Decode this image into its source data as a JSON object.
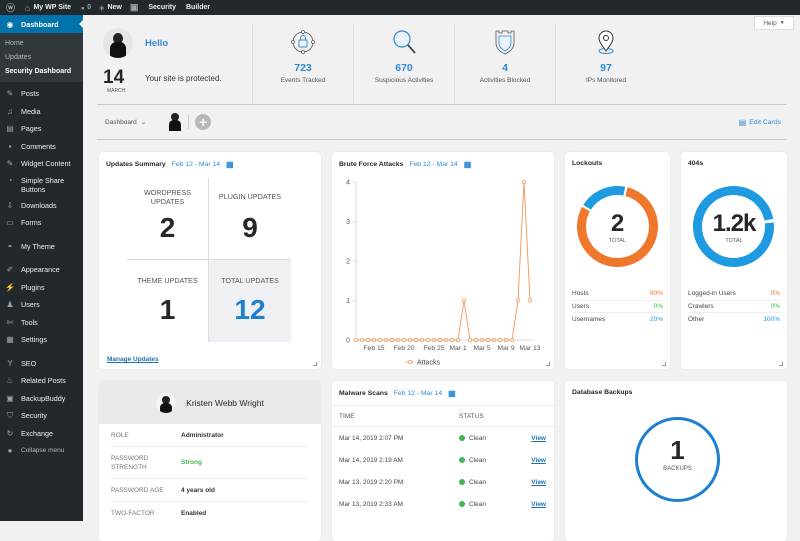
{
  "adminbar": {
    "wp_icon": "wordpress-logo-icon",
    "site_name": "My WP Site",
    "comments_count": "0",
    "new_label": "New",
    "security_label": "Security",
    "builder_label": "Builder"
  },
  "sidebar": {
    "active": "Dashboard",
    "submenu": [
      "Home",
      "Updates",
      "Security Dashboard"
    ],
    "items": [
      {
        "label": "Posts",
        "icon": "pin-icon"
      },
      {
        "label": "Media",
        "icon": "media-icon"
      },
      {
        "label": "Pages",
        "icon": "pages-icon"
      },
      {
        "label": "Comments",
        "icon": "comment-icon"
      },
      {
        "label": "Widget Content",
        "icon": "pin-icon"
      },
      {
        "label": "Simple Share Buttons",
        "icon": "share-icon"
      },
      {
        "label": "Downloads",
        "icon": "download-icon"
      },
      {
        "label": "Forms",
        "icon": "forms-icon"
      },
      {
        "label": "My Theme",
        "icon": "theme-icon"
      },
      {
        "label": "Appearance",
        "icon": "brush-icon"
      },
      {
        "label": "Plugins",
        "icon": "plugin-icon"
      },
      {
        "label": "Users",
        "icon": "users-icon"
      },
      {
        "label": "Tools",
        "icon": "wrench-icon"
      },
      {
        "label": "Settings",
        "icon": "settings-icon"
      },
      {
        "label": "SEO",
        "icon": "seo-icon"
      },
      {
        "label": "Related Posts",
        "icon": "flame-icon"
      },
      {
        "label": "BackupBuddy",
        "icon": "backup-icon"
      },
      {
        "label": "Security",
        "icon": "shield-icon"
      },
      {
        "label": "Exchange",
        "icon": "exchange-icon"
      }
    ],
    "collapse": "Collapse menu"
  },
  "hero": {
    "day": "14",
    "month": "MARCH",
    "greeting": "Hello",
    "message": "Your site is protected.",
    "stats": [
      {
        "value": "723",
        "label": "Events Tracked"
      },
      {
        "value": "670",
        "label": "Suspicious Activities"
      },
      {
        "value": "4",
        "label": "Activities Blocked"
      },
      {
        "value": "97",
        "label": "IPs Monitored"
      }
    ],
    "help": "Help"
  },
  "toolbar": {
    "dashboard_select": "Dashboard",
    "edit_cards": "Edit Cards"
  },
  "updates": {
    "title": "Updates Summary",
    "range": "Feb 12 - Mar 14",
    "cells": [
      {
        "label": "WORDPRESS UPDATES",
        "value": "2"
      },
      {
        "label": "PLUGIN UPDATES",
        "value": "9"
      },
      {
        "label": "THEME UPDATES",
        "value": "1"
      },
      {
        "label": "TOTAL UPDATES",
        "value": "12"
      }
    ],
    "manage": "Manage Updates"
  },
  "brute": {
    "title": "Brute Force Attacks",
    "range": "Feb 12 - Mar 14"
  },
  "chart_data": {
    "type": "line",
    "title": "Brute Force Attacks",
    "xlabel": "",
    "ylabel": "",
    "ylim": [
      0,
      4
    ],
    "yticks": [
      "0",
      "1",
      "2",
      "3",
      "4"
    ],
    "xticks": [
      "Feb 15",
      "Feb 20",
      "Feb 25",
      "Mar 1",
      "Mar 5",
      "Mar 9",
      "Mar 13"
    ],
    "x": [
      "Feb 12",
      "Feb 13",
      "Feb 14",
      "Feb 15",
      "Feb 16",
      "Feb 17",
      "Feb 18",
      "Feb 19",
      "Feb 20",
      "Feb 21",
      "Feb 22",
      "Feb 23",
      "Feb 24",
      "Feb 25",
      "Feb 26",
      "Feb 27",
      "Feb 28",
      "Mar 1",
      "Mar 2",
      "Mar 3",
      "Mar 4",
      "Mar 5",
      "Mar 6",
      "Mar 7",
      "Mar 8",
      "Mar 9",
      "Mar 10",
      "Mar 11",
      "Mar 12",
      "Mar 13"
    ],
    "series": [
      {
        "name": "Attacks",
        "color": "#f0955a",
        "values": [
          0,
          0,
          0,
          0,
          0,
          0,
          0,
          0,
          0,
          0,
          0,
          0,
          0,
          0,
          0,
          0,
          0,
          0,
          1,
          0,
          0,
          0,
          0,
          0,
          0,
          0,
          0,
          1,
          4,
          1
        ]
      }
    ],
    "legend": "bottom"
  },
  "lockouts": {
    "title": "Lockouts",
    "total": "2",
    "total_label": "TOTAL",
    "rows": [
      {
        "label": "Hosts",
        "value": "80%",
        "color": "#f0782d",
        "pct": 80
      },
      {
        "label": "Users",
        "value": "0%",
        "color": "#46b450",
        "pct": 0
      },
      {
        "label": "Usernames",
        "value": "20%",
        "color": "#1e9be0",
        "pct": 20
      }
    ]
  },
  "f404": {
    "title": "404s",
    "total": "1.2k",
    "total_label": "TOTAL",
    "rows": [
      {
        "label": "Logged-in Users",
        "value": "0%",
        "color": "#f0782d",
        "pct": 0
      },
      {
        "label": "Crawlers",
        "value": "0%",
        "color": "#46b450",
        "pct": 0
      },
      {
        "label": "Other",
        "value": "100%",
        "color": "#1e9be0",
        "pct": 100
      }
    ]
  },
  "profile": {
    "name": "Kristen Webb Wright",
    "rows": [
      {
        "key": "ROLE",
        "value": "Administrator"
      },
      {
        "key": "PASSWORD STRENGTH",
        "value": "Strong",
        "color": "#46b450"
      },
      {
        "key": "PASSWORD AGE",
        "value": "4 years old"
      },
      {
        "key": "TWO-FACTOR",
        "value": "Enabled"
      }
    ]
  },
  "malware": {
    "title": "Malware Scans",
    "range": "Feb 12 - Mar 14",
    "col_time": "TIME",
    "col_status": "STATUS",
    "rows": [
      {
        "time": "Mar 14, 2019 2:07 PM",
        "status": "Clean",
        "link": "View"
      },
      {
        "time": "Mar 14, 2019 2:19 AM",
        "status": "Clean",
        "link": "View"
      },
      {
        "time": "Mar 13, 2019 2:20 PM",
        "status": "Clean",
        "link": "View"
      },
      {
        "time": "Mar 13, 2019 2:33 AM",
        "status": "Clean",
        "link": "View"
      }
    ]
  },
  "backups": {
    "title": "Database Backups",
    "count": "1",
    "label": "BACKUPS"
  }
}
